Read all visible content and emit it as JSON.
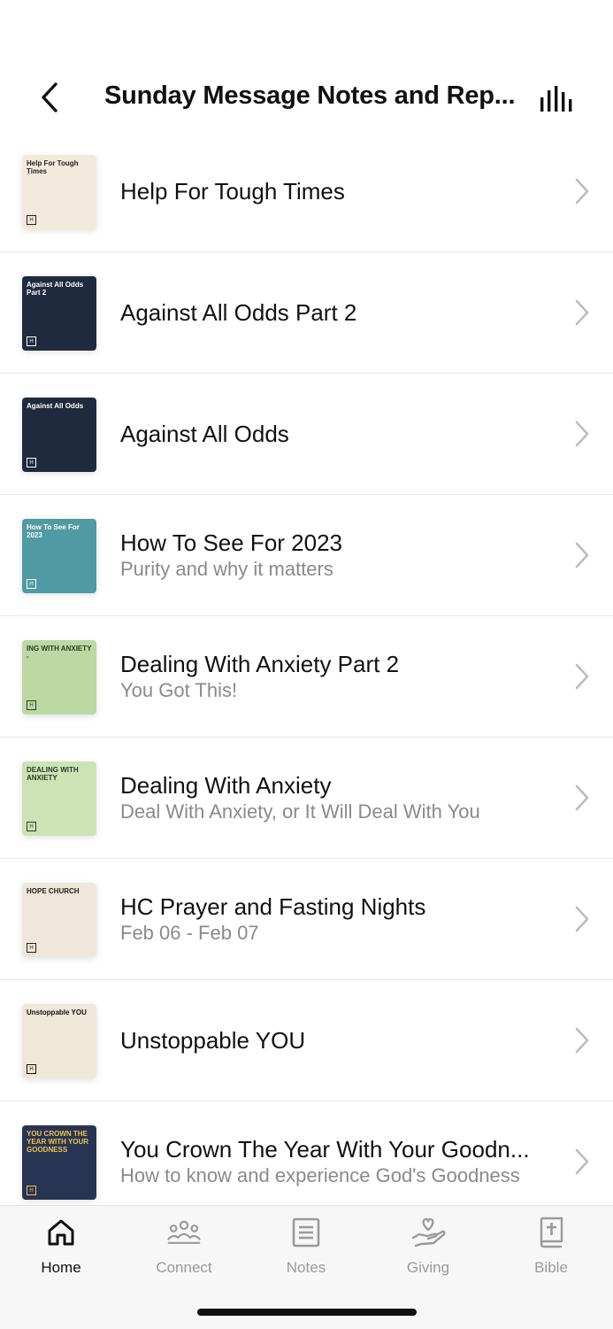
{
  "header": {
    "title": "Sunday Message Notes and Rep..."
  },
  "items": [
    {
      "title": "Help For Tough Times",
      "subtitle": "",
      "thumb_text": "Help For Tough Times",
      "thumb_bg": "#f2e9dd",
      "thumb_fg": "#222222"
    },
    {
      "title": "Against All Odds Part 2",
      "subtitle": "",
      "thumb_text": "Against All Odds Part 2",
      "thumb_bg": "#1f2a3f",
      "thumb_fg": "#ffffff"
    },
    {
      "title": "Against All Odds",
      "subtitle": "",
      "thumb_text": "Against All Odds",
      "thumb_bg": "#1f2a3f",
      "thumb_fg": "#ffffff"
    },
    {
      "title": "How To See For 2023",
      "subtitle": "Purity and why it matters",
      "thumb_text": "How To See For 2023",
      "thumb_bg": "#4f9aa3",
      "thumb_fg": "#ffffff"
    },
    {
      "title": "Dealing With Anxiety Part 2",
      "subtitle": "You Got This!",
      "thumb_text": "ING WITH ANXIETY -",
      "thumb_bg": "#bcd9a4",
      "thumb_fg": "#2b3a22"
    },
    {
      "title": "Dealing With Anxiety",
      "subtitle": "Deal With Anxiety, or It Will Deal With You",
      "thumb_text": "DEALING WITH ANXIETY",
      "thumb_bg": "#cde3b6",
      "thumb_fg": "#2b3a22"
    },
    {
      "title": "HC Prayer and Fasting Nights",
      "subtitle": "Feb 06 - Feb 07",
      "thumb_text": "HOPE CHURCH",
      "thumb_bg": "#efe6dc",
      "thumb_fg": "#222222"
    },
    {
      "title": "Unstoppable YOU",
      "subtitle": "",
      "thumb_text": "Unstoppable YOU",
      "thumb_bg": "#efe7d8",
      "thumb_fg": "#111111"
    },
    {
      "title": "You Crown The Year With Your Goodn...",
      "subtitle": "How to know and experience God's Goodness",
      "thumb_text": "YOU CROWN THE YEAR WITH YOUR GOODNESS",
      "thumb_bg": "#283454",
      "thumb_fg": "#f0c24a"
    }
  ],
  "tabs": [
    {
      "label": "Home",
      "icon": "home-icon",
      "active": true
    },
    {
      "label": "Connect",
      "icon": "people-icon",
      "active": false
    },
    {
      "label": "Notes",
      "icon": "notes-icon",
      "active": false
    },
    {
      "label": "Giving",
      "icon": "giving-icon",
      "active": false
    },
    {
      "label": "Bible",
      "icon": "bible-icon",
      "active": false
    }
  ],
  "colors": {
    "accent": "#111111",
    "inactive": "#9a9a9a",
    "divider": "#e6e6e6"
  }
}
